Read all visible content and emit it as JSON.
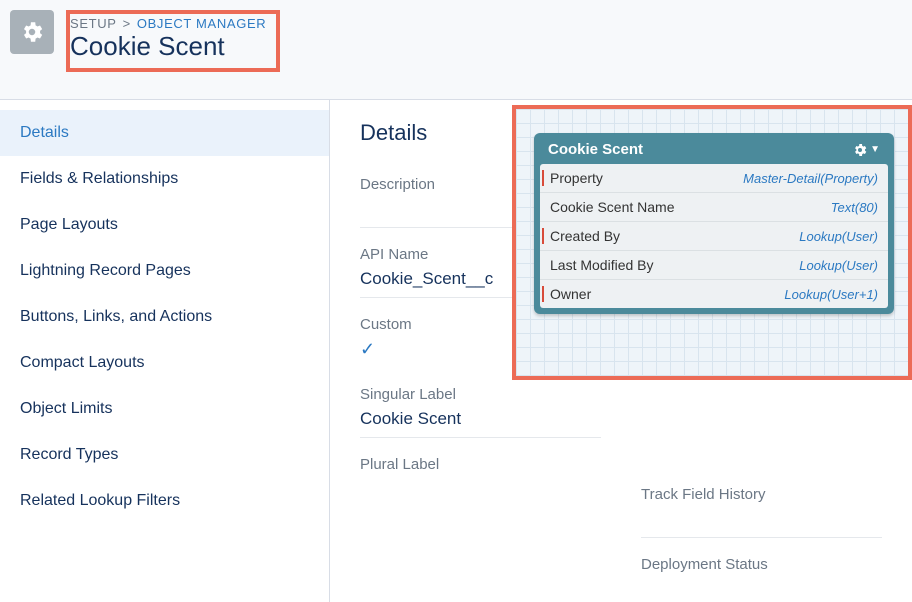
{
  "header": {
    "breadcrumb_setup": "SETUP",
    "breadcrumb_sep": ">",
    "breadcrumb_objmgr": "OBJECT MANAGER",
    "page_title": "Cookie Scent"
  },
  "sidebar": {
    "items": [
      {
        "label": "Details",
        "active": true
      },
      {
        "label": "Fields & Relationships"
      },
      {
        "label": "Page Layouts"
      },
      {
        "label": "Lightning Record Pages"
      },
      {
        "label": "Buttons, Links, and Actions"
      },
      {
        "label": "Compact Layouts"
      },
      {
        "label": "Object Limits"
      },
      {
        "label": "Record Types"
      },
      {
        "label": "Related Lookup Filters"
      }
    ]
  },
  "details": {
    "section_title": "Details",
    "labels": {
      "description": "Description",
      "api_name": "API Name",
      "custom": "Custom",
      "singular": "Singular Label",
      "plural": "Plural Label",
      "track": "Track Field History",
      "deployment": "Deployment Status"
    },
    "values": {
      "api_name": "Cookie_Scent__c",
      "singular": "Cookie Scent"
    }
  },
  "schema": {
    "title": "Cookie Scent",
    "rows": [
      {
        "name": "Property",
        "type": "Master-Detail(Property)",
        "mark": true
      },
      {
        "name": "Cookie Scent Name",
        "type": "Text(80)",
        "mark": false
      },
      {
        "name": "Created By",
        "type": "Lookup(User)",
        "mark": true
      },
      {
        "name": "Last Modified By",
        "type": "Lookup(User)",
        "mark": false
      },
      {
        "name": "Owner",
        "type": "Lookup(User+1)",
        "mark": true
      }
    ]
  }
}
